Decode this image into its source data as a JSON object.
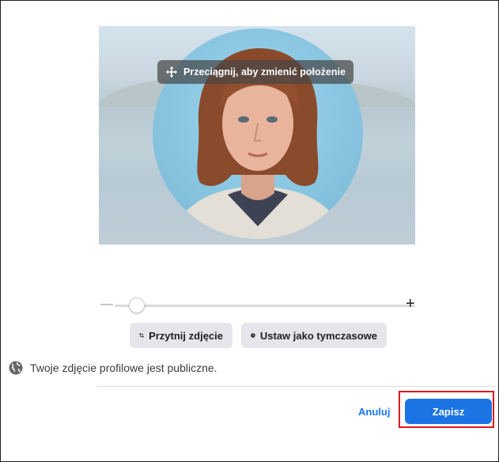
{
  "photo_editor": {
    "drag_hint": "Przeciągnij, aby zmienić położenie",
    "zoom_level": 0.05,
    "crop_button": "Przytnij zdjęcie",
    "temporary_button": "Ustaw jako tymczasowe"
  },
  "privacy": {
    "text": "Twoje zdjęcie profilowe jest publiczne."
  },
  "footer": {
    "cancel_label": "Anuluj",
    "save_label": "Zapisz"
  },
  "colors": {
    "primary": "#1b74e4",
    "highlight": "#e0151c",
    "button_bg": "#e4e6eb"
  },
  "icons": {
    "drag": "move-arrows-icon",
    "crop": "crop-icon",
    "temporary": "clock-icon",
    "privacy": "globe-icon"
  }
}
